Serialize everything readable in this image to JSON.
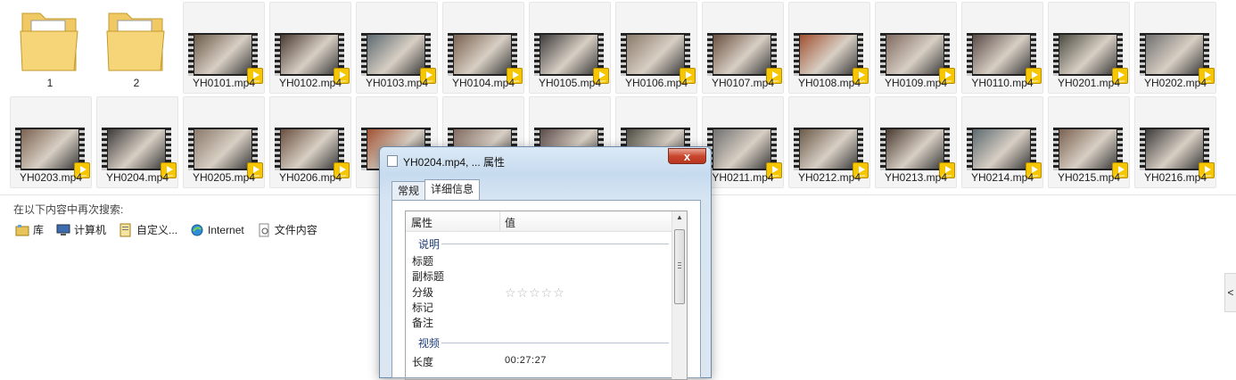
{
  "folders": [
    {
      "label": "1"
    },
    {
      "label": "2"
    }
  ],
  "row1_files": [
    "YH0101.mp4",
    "YH0102.mp4",
    "YH0103.mp4",
    "YH0104.mp4",
    "YH0105.mp4",
    "YH0106.mp4",
    "YH0107.mp4",
    "YH0108.mp4",
    "YH0109.mp4",
    "YH0110.mp4",
    "YH0201.mp4",
    "YH0202.mp4"
  ],
  "row2_files": [
    "YH0203.mp4",
    "YH0204.mp4",
    "YH0205.mp4",
    "YH0206.mp4",
    "YH0",
    "",
    "",
    "",
    "YH0211.mp4",
    "YH0212.mp4",
    "YH0213.mp4",
    "YH0214.mp4",
    "YH0215.mp4",
    "YH0216.mp4"
  ],
  "badge_text": "Player",
  "search": {
    "header": "在以下内容中再次搜索:",
    "options": [
      {
        "label": "库",
        "icon": "library-icon"
      },
      {
        "label": "计算机",
        "icon": "computer-icon"
      },
      {
        "label": "自定义...",
        "icon": "custom-folder-icon"
      },
      {
        "label": "Internet",
        "icon": "internet-icon"
      },
      {
        "label": "文件内容",
        "icon": "file-content-icon"
      }
    ]
  },
  "side_tab": "<",
  "dialog": {
    "title": "YH0204.mp4, ... 属性",
    "close": "x",
    "tabs": [
      "常规",
      "详细信息"
    ],
    "active_tab": 1,
    "header_col1": "属性",
    "header_col2": "值",
    "groups": {
      "description": "说明",
      "video": "视频"
    },
    "description_props": [
      "标题",
      "副标题",
      "分级",
      "标记",
      "备注"
    ],
    "rating": "☆☆☆☆☆",
    "video_props": [
      {
        "name": "长度",
        "value": "00:27:27"
      }
    ]
  },
  "colors": {
    "badge": "#f6c600",
    "close_button": "#c9472e",
    "group_text": "#1e3f78"
  }
}
